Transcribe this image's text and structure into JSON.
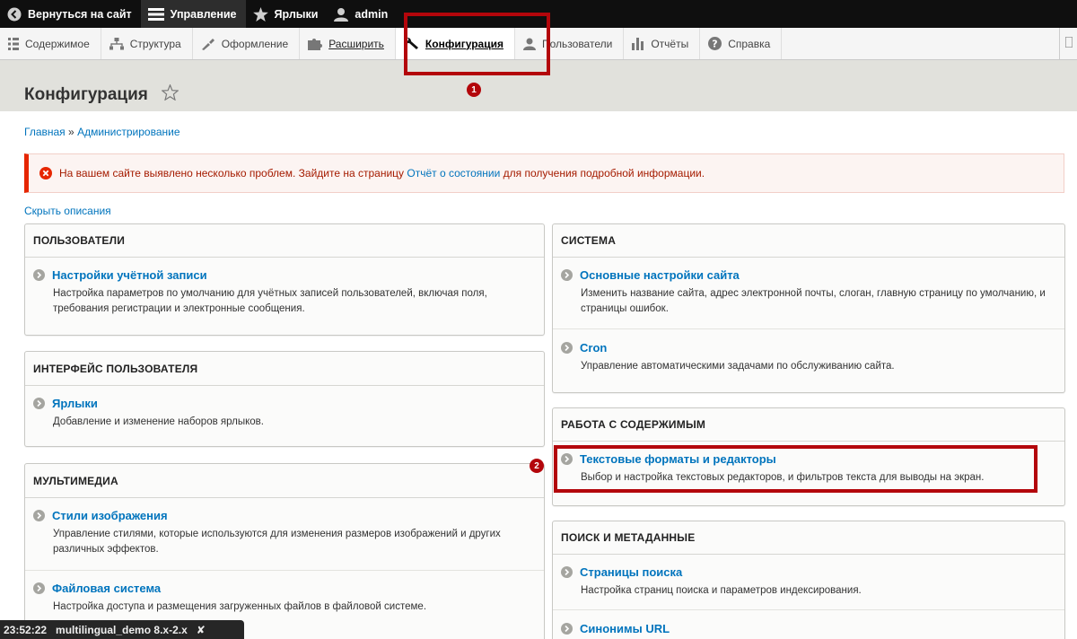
{
  "toolbar": {
    "back": "Вернуться на сайт",
    "manage": "Управление",
    "shortcuts": "Ярлыки",
    "user": "admin"
  },
  "tray": {
    "content": "Содержимое",
    "structure": "Структура",
    "appearance": "Оформление",
    "extend": "Расширить",
    "config": "Конфигурация",
    "people": "Пользователи",
    "reports": "Отчёты",
    "help": "Справка"
  },
  "page": {
    "title": "Конфигурация",
    "breadcrumb": {
      "home": "Главная",
      "sep": "»",
      "admin": "Администрирование"
    },
    "error": {
      "before": "На вашем сайте выявлено несколько проблем. Зайдите на страницу ",
      "link": "Отчёт о состоянии",
      "after": " для получения подробной информации."
    },
    "toggle_desc": "Скрыть описания"
  },
  "panels": {
    "users": {
      "title": "ПОЛЬЗОВАТЕЛИ",
      "items": [
        {
          "label": "Настройки учётной записи",
          "desc": "Настройка параметров по умолчанию для учётных записей пользователей, включая поля, требования регистрации и электронные сообщения."
        }
      ]
    },
    "ui": {
      "title": "ИНТЕРФЕЙС ПОЛЬЗОВАТЕЛЯ",
      "items": [
        {
          "label": "Ярлыки",
          "desc": "Добавление и изменение наборов ярлыков."
        }
      ]
    },
    "media": {
      "title": "МУЛЬТИМЕДИА",
      "items": [
        {
          "label": "Стили изображения",
          "desc": "Управление стилями, которые используются для изменения размеров изображений и других различных эффектов."
        },
        {
          "label": "Файловая система",
          "desc": "Настройка доступа и размещения загруженных файлов в файловой системе."
        }
      ]
    },
    "system": {
      "title": "СИСТЕМА",
      "items": [
        {
          "label": "Основные настройки сайта",
          "desc": "Изменить название сайта, адрес электронной почты, слоган, главную страницу по умолчанию, и страницы ошибок."
        },
        {
          "label": "Cron",
          "desc": "Управление автоматическими задачами по обслуживанию сайта."
        }
      ]
    },
    "content": {
      "title": "РАБОТА С СОДЕРЖИМЫМ",
      "items": [
        {
          "label": "Текстовые форматы и редакторы",
          "desc": "Выбор и настройка текстовых редакторов, и фильтров текста для выводы на экран."
        }
      ]
    },
    "search": {
      "title": "ПОИСК И МЕТАДАННЫЕ",
      "items": [
        {
          "label": "Страницы поиска",
          "desc": "Настройка страниц поиска и параметров индексирования."
        },
        {
          "label": "Синонимы URL",
          "desc": ""
        }
      ]
    }
  },
  "annotations": {
    "one": "1",
    "two": "2",
    "color": "#b3060b"
  },
  "overlay": {
    "time": "23:52:22",
    "name": "multilingual_demo 8.x-2.x",
    "close": "✘"
  },
  "colors": {
    "link": "#0074bd",
    "toolbar": "#0f0f0f",
    "error": "#e62600"
  }
}
